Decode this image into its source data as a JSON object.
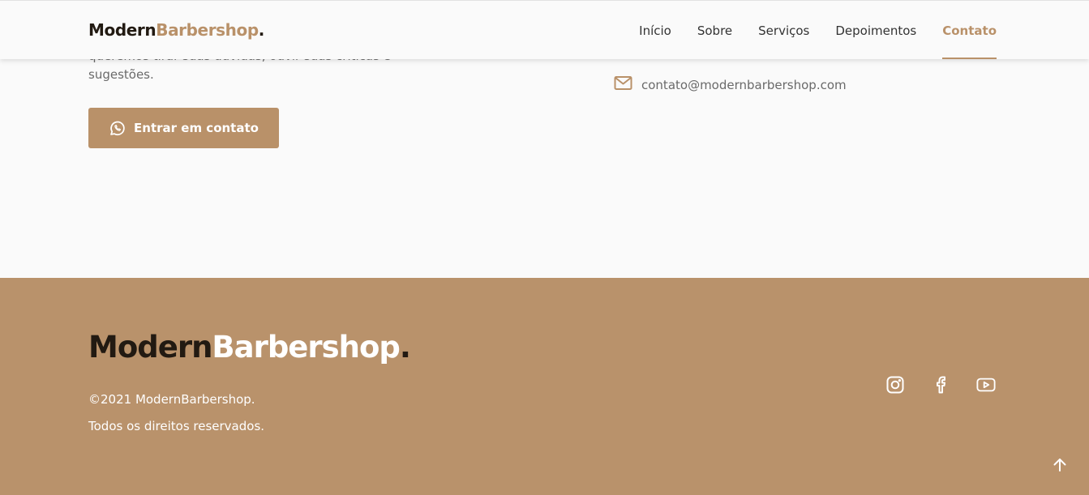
{
  "header": {
    "logo": {
      "part1": "Modern",
      "part2": "Barbershop",
      "part3": "."
    },
    "nav": [
      {
        "label": "Início"
      },
      {
        "label": "Sobre"
      },
      {
        "label": "Serviços"
      },
      {
        "label": "Depoimentos"
      },
      {
        "label": "Contato",
        "active": true
      }
    ]
  },
  "contact": {
    "text_visible": "queremos tirar suas dúvidas, ouvir suas críticas e sugestões.",
    "button_label": "Entrar em contato",
    "button_icon": "whatsapp-icon",
    "email": "contato@modernbarbershop.com",
    "email_icon": "mail-icon"
  },
  "footer": {
    "logo": {
      "part1": "Modern",
      "part2": "Barbershop",
      "part3": "."
    },
    "copyright": "©2021 ModernBarbershop.",
    "rights": "Todos os direitos reservados.",
    "social": [
      "instagram-icon",
      "facebook-icon",
      "youtube-icon"
    ],
    "back_to_top_icon": "arrow-up-icon"
  },
  "colors": {
    "accent": "#b99169",
    "dark": "#221a12",
    "background": "#fafafa",
    "footer_bg": "#b9926b"
  }
}
